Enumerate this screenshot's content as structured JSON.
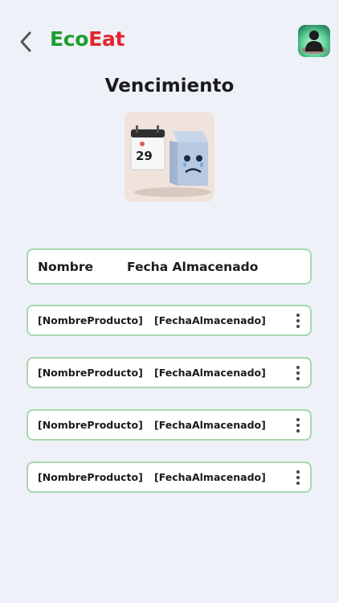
{
  "app": {
    "name_part1": "Eco",
    "name_part2": "Eat",
    "brand_colors": {
      "eco": "#1e9e2f",
      "eat": "#e0262c"
    }
  },
  "header": {
    "back_icon": "chevron-left-icon",
    "profile_icon": "user-avatar-icon"
  },
  "page": {
    "title": "Vencimiento",
    "illustration": "expired-milk-carton-calendar-illustration"
  },
  "table": {
    "headers": [
      "Nombre",
      "Fecha Almacenado"
    ],
    "rows": [
      {
        "name": "[NombreProducto]",
        "date": "[FechaAlmacenado]"
      },
      {
        "name": "[NombreProducto]",
        "date": "[FechaAlmacenado]"
      },
      {
        "name": "[NombreProducto]",
        "date": "[FechaAlmacenado]"
      },
      {
        "name": "[NombreProducto]",
        "date": "[FechaAlmacenado]"
      }
    ],
    "row_menu_icon": "more-vertical-icon",
    "border_color": "#a7d7ad"
  }
}
